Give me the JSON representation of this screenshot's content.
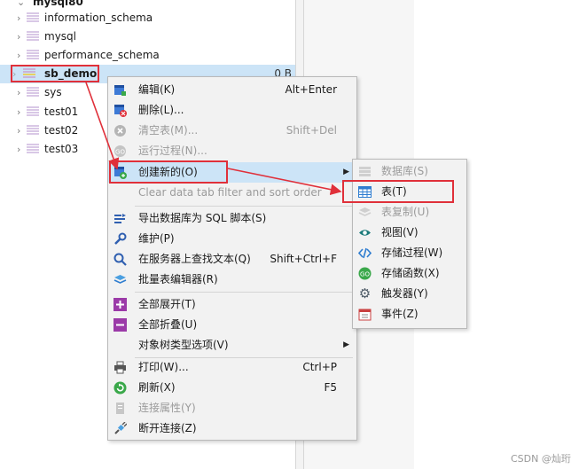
{
  "tree": {
    "root_label": "mysql80",
    "items": [
      {
        "label": "information_schema"
      },
      {
        "label": "mysql"
      },
      {
        "label": "performance_schema"
      },
      {
        "label": "sb_demo",
        "size": "0 B"
      },
      {
        "label": "sys"
      },
      {
        "label": "test01"
      },
      {
        "label": "test02"
      },
      {
        "label": "test03"
      }
    ]
  },
  "context_menu": {
    "items": [
      {
        "label": "编辑(K)",
        "shortcut": "Alt+Enter"
      },
      {
        "label": "删除(L)..."
      },
      {
        "label": "清空表(M)...",
        "shortcut": "Shift+Del"
      },
      {
        "label": "运行过程(N)..."
      },
      {
        "label": "创建新的(O)"
      },
      {
        "label": "Clear data tab filter and sort order"
      },
      {
        "label": "导出数据库为 SQL 脚本(S)"
      },
      {
        "label": "维护(P)"
      },
      {
        "label": "在服务器上查找文本(Q)",
        "shortcut": "Shift+Ctrl+F"
      },
      {
        "label": "批量表编辑器(R)"
      },
      {
        "label": "全部展开(T)"
      },
      {
        "label": "全部折叠(U)"
      },
      {
        "label": "对象树类型选项(V)"
      },
      {
        "label": "打印(W)...",
        "shortcut": "Ctrl+P"
      },
      {
        "label": "刷新(X)",
        "shortcut": "F5"
      },
      {
        "label": "连接属性(Y)"
      },
      {
        "label": "断开连接(Z)"
      }
    ]
  },
  "submenu": {
    "items": [
      {
        "label": "数据库(S)"
      },
      {
        "label": "表(T)"
      },
      {
        "label": "表复制(U)"
      },
      {
        "label": "视图(V)"
      },
      {
        "label": "存储过程(W)"
      },
      {
        "label": "存储函数(X)"
      },
      {
        "label": "触发器(Y)"
      },
      {
        "label": "事件(Z)"
      }
    ]
  },
  "watermark": "CSDN @灿珩",
  "colors": {
    "highlight": "#cce4f7",
    "annotation": "#e0303a",
    "menu_bg": "#f2f2f2"
  }
}
